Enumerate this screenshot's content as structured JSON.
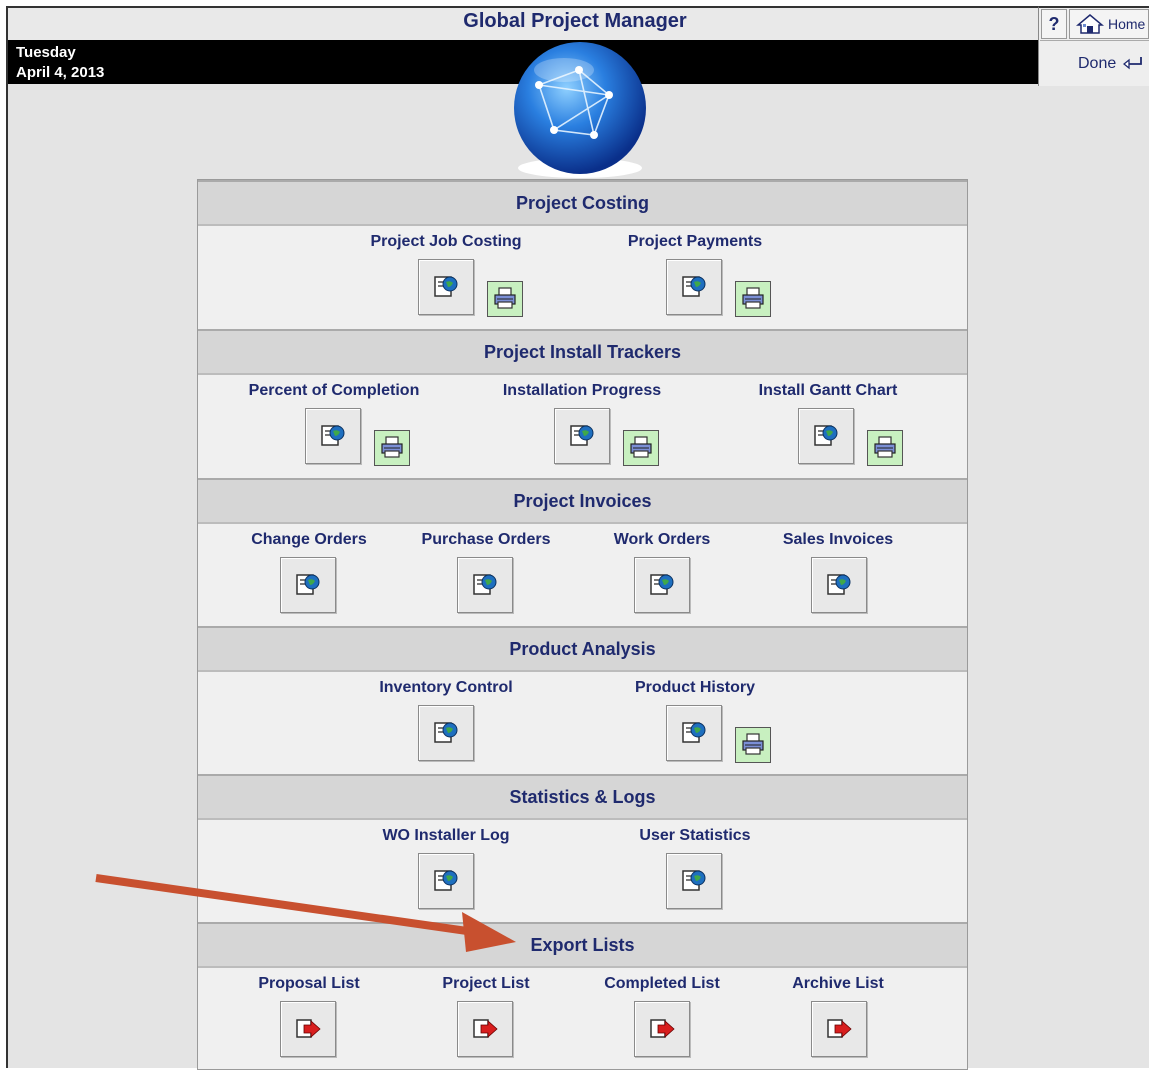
{
  "header": {
    "title": "Global Project Manager",
    "day": "Tuesday",
    "date": "April 4, 2013",
    "help_label": "?",
    "home_label": "Home",
    "done_label": "Done"
  },
  "sections": [
    {
      "title": "Project Costing",
      "items": [
        {
          "label": "Project Job Costing",
          "print": true
        },
        {
          "label": "Project Payments",
          "print": true
        }
      ]
    },
    {
      "title": "Project Install Trackers",
      "items": [
        {
          "label": "Percent of Completion",
          "print": true
        },
        {
          "label": "Installation Progress",
          "print": true
        },
        {
          "label": "Install Gantt Chart",
          "print": true
        }
      ]
    },
    {
      "title": "Project Invoices",
      "items": [
        {
          "label": "Change Orders",
          "print": false
        },
        {
          "label": "Purchase Orders",
          "print": false
        },
        {
          "label": "Work Orders",
          "print": false
        },
        {
          "label": "Sales Invoices",
          "print": false
        }
      ]
    },
    {
      "title": "Product Analysis",
      "items": [
        {
          "label": "Inventory Control",
          "print": false
        },
        {
          "label": "Product History",
          "print": true
        }
      ]
    },
    {
      "title": "Statistics & Logs",
      "items": [
        {
          "label": "WO Installer Log",
          "print": false
        },
        {
          "label": "User Statistics",
          "print": false
        }
      ]
    },
    {
      "title": "Export Lists",
      "items": [
        {
          "label": "Proposal List",
          "print": false
        },
        {
          "label": "Project List",
          "print": false
        },
        {
          "label": "Completed List",
          "print": false
        },
        {
          "label": "Archive List",
          "print": false
        }
      ]
    }
  ],
  "icons": {
    "report": "report-globe-icon",
    "print": "printer-icon",
    "export": "export-arrow-icon",
    "globe": "globe-logo"
  },
  "colors": {
    "text": "#1f2a6e",
    "header_bar": "#000000",
    "section_head": "#d6d6d6",
    "print_bg": "#c8f0c0",
    "annotation_arrow": "#c8502f"
  }
}
